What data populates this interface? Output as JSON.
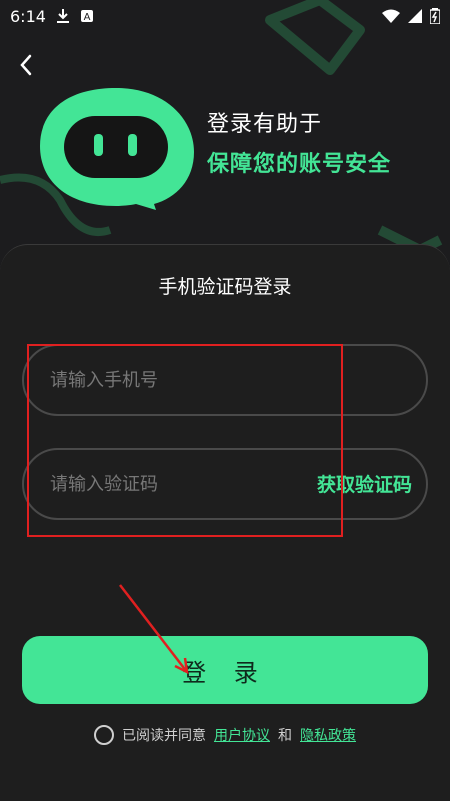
{
  "status_bar": {
    "time": "6:14",
    "download_icon": "download-icon",
    "a_icon": "a-icon",
    "wifi_icon": "wifi-icon",
    "signal_icon": "signal-icon",
    "battery_icon": "battery-icon"
  },
  "hero": {
    "line1": "登录有助于",
    "line2": "保障您的账号安全"
  },
  "card": {
    "title": "手机验证码登录",
    "phone_placeholder": "请输入手机号",
    "code_placeholder": "请输入验证码",
    "get_code_label": "获取验证码"
  },
  "login_button_label": "登 录",
  "agreement": {
    "prefix": "已阅读并同意",
    "user_agreement": "用户协议",
    "and": "和",
    "privacy_policy": "隐私政策"
  },
  "colors": {
    "accent": "#43e596",
    "background": "#1c1c1e",
    "highlight": "#e02020"
  }
}
